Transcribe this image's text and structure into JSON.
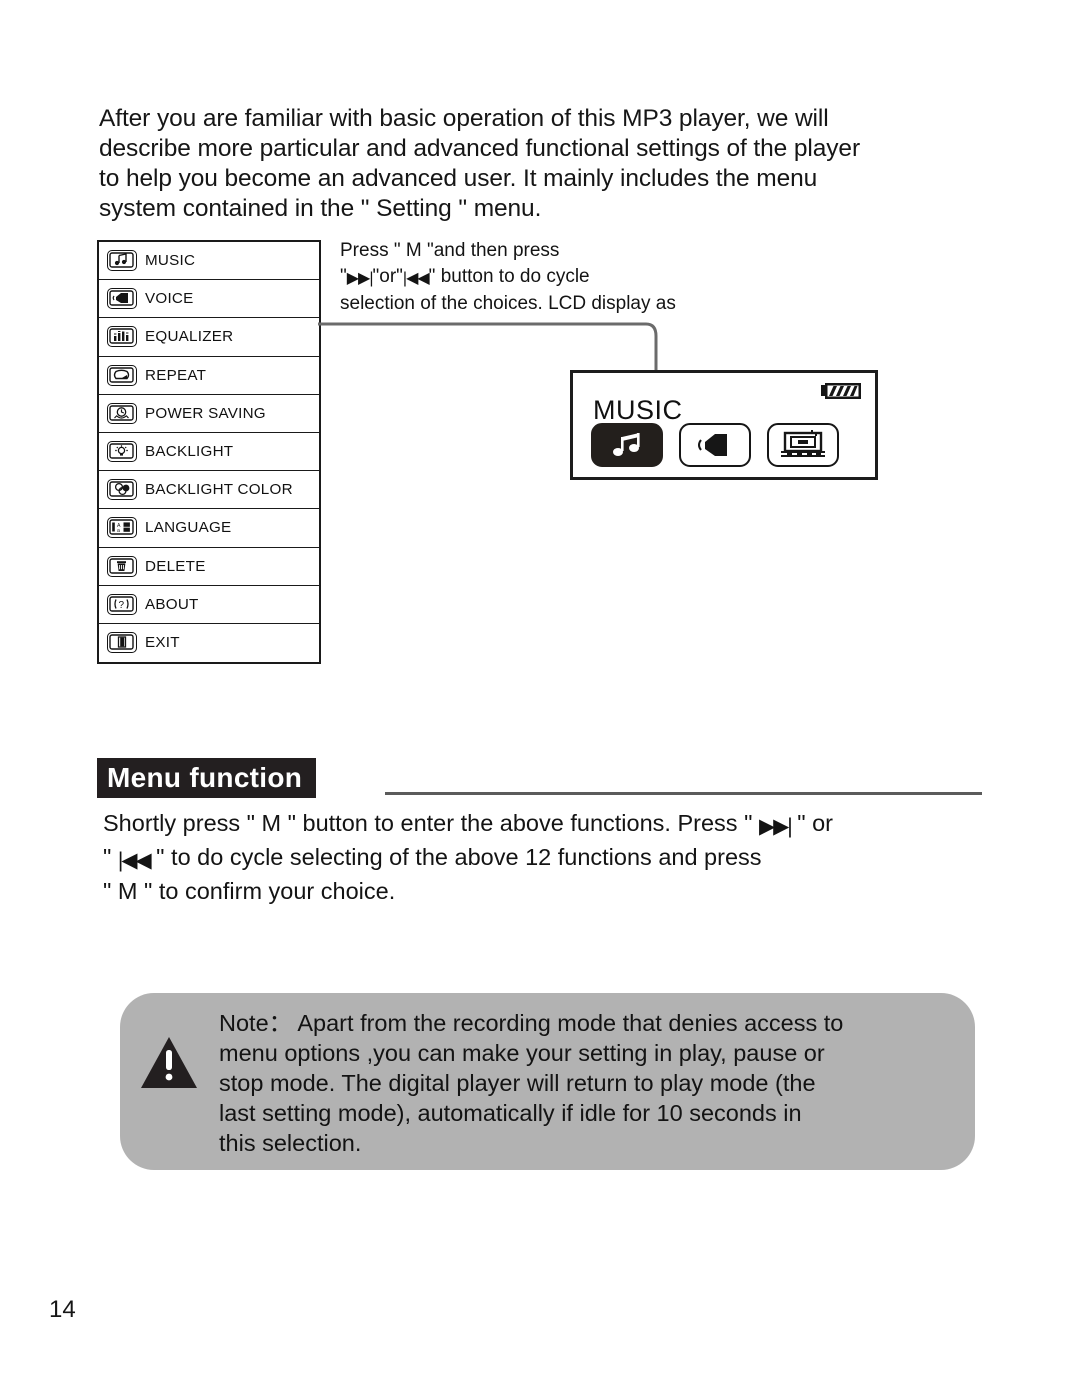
{
  "intro": {
    "lines": [
      "After you are familiar with basic operation of this MP3 player, we will",
      "describe more particular and advanced functional settings of the player",
      "to help you become an advanced user. It mainly includes the menu",
      "system contained in the \" Setting \" menu."
    ]
  },
  "menu_table": {
    "items": [
      {
        "label": "MUSIC",
        "icon": "music-note-icon"
      },
      {
        "label": "VOICE",
        "icon": "voice-recorder-icon"
      },
      {
        "label": "EQUALIZER",
        "icon": "equalizer-bars-icon"
      },
      {
        "label": "REPEAT",
        "icon": "repeat-loop-icon"
      },
      {
        "label": "POWER SAVING",
        "icon": "power-saving-clock-icon"
      },
      {
        "label": "BACKLIGHT",
        "icon": "backlight-bulb-icon"
      },
      {
        "label": "BACKLIGHT COLOR",
        "icon": "backlight-color-circles-icon"
      },
      {
        "label": "LANGUAGE",
        "icon": "language-characters-icon"
      },
      {
        "label": "DELETE",
        "icon": "delete-trash-icon"
      },
      {
        "label": "ABOUT",
        "icon": "about-question-icon"
      },
      {
        "label": "EXIT",
        "icon": "exit-door-icon"
      }
    ]
  },
  "callout": {
    "line1_a": "Press \" M \"and then press",
    "line2_a": "\"",
    "line2_fwd": "▶▶|",
    "line2_b": "\"or\"",
    "line2_rew": "|◀◀",
    "line2_c": "\" button to do cycle",
    "line3": "selection of the choices. LCD display as"
  },
  "lcd": {
    "title": "MUSIC",
    "battery": "battery-full-icon",
    "keys": [
      {
        "name": "music-mode-key",
        "icon": "music-note-icon",
        "selected": true
      },
      {
        "name": "voice-mode-key",
        "icon": "voice-recorder-icon",
        "selected": false
      },
      {
        "name": "settings-mode-key",
        "icon": "settings-display-icon",
        "selected": false
      }
    ]
  },
  "section": {
    "heading": "Menu function",
    "body": {
      "line1_a": "Shortly press \" M \" button to enter the above functions. Press \" ",
      "line1_fwd": "▶▶|",
      "line1_b": " \" or",
      "line2_a": "\" ",
      "line2_rew": "|◀◀",
      "line2_b": " \"  to do cycle selecting of the above 12 functions and press",
      "line3": "\" M \" to confirm your choice."
    }
  },
  "note": {
    "icon": "warning-triangle-icon",
    "lines": [
      "Note： Apart from the recording mode that denies access to",
      "menu options ,you can make your setting in play, pause or",
      "stop mode. The digital player will return to play mode (the",
      "last setting mode), automatically if idle for 10 seconds in",
      "this selection."
    ]
  },
  "footer": {
    "page_number": "14"
  },
  "colors": {
    "ink": "#141414",
    "heading_bg": "#231f20",
    "note_bg": "#b2b2b2",
    "rule": "#5b5b5b"
  }
}
